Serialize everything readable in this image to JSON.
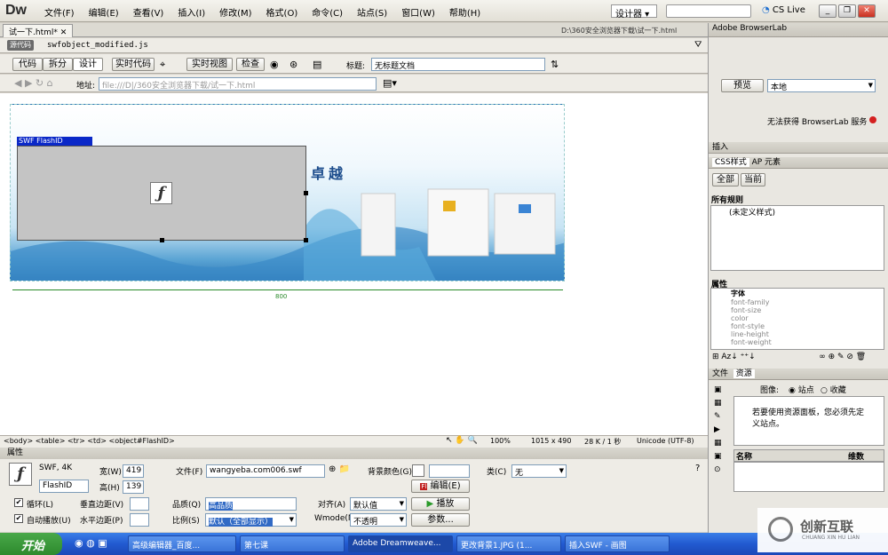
{
  "app": {
    "logo": "Dw",
    "menus": [
      "文件(F)",
      "编辑(E)",
      "查看(V)",
      "插入(I)",
      "修改(M)",
      "格式(O)",
      "命令(C)",
      "站点(S)",
      "窗口(W)",
      "帮助(H)"
    ],
    "workspace": "设计器",
    "cslive": "CS Live"
  },
  "doc": {
    "tab": "试一下.html*",
    "path": "D:\\360安全浏览器下载\\试一下.html",
    "source_chip": "源代码",
    "related_file": "swfobject_modified.js"
  },
  "toolbar": {
    "code": "代码",
    "split": "拆分",
    "design": "设计",
    "live_code": "实时代码",
    "live_view": "实时视图",
    "inspect": "检查",
    "title_label": "标题:",
    "title_value": "无标题文档"
  },
  "address": {
    "label": "地址:",
    "value": "file:///D|/360安全浏览器下载/试一下.html"
  },
  "canvas": {
    "swf_label": "SWF  FlashID",
    "slogan": "卓越",
    "ruler_width": "800"
  },
  "status": {
    "tags": "<body> <table> <tr> <td> <object#FlashID>",
    "zoom": "100%",
    "size": "1015 x 490",
    "weight": "28 K / 1 秒",
    "encoding": "Unicode (UTF-8)"
  },
  "props": {
    "header": "属性",
    "kind": "SWF, 4K",
    "id": "FlashID",
    "w_label": "宽(W)",
    "w": "419",
    "h_label": "高(H)",
    "h": "139",
    "file_label": "文件(F)",
    "file": "wangyeba.com006.swf",
    "bg_label": "背景颜色(G)",
    "edit": "编辑(E)",
    "class_label": "类(C)",
    "class_val": "无",
    "loop": "循环(L)",
    "autoplay": "自动播放(U)",
    "vspace": "垂直边距(V)",
    "hspace": "水平边距(P)",
    "quality_label": "品质(Q)",
    "quality": "高品质",
    "scale_label": "比例(S)",
    "scale": "默认（全部显示）",
    "align_label": "对齐(A)",
    "align": "默认值",
    "wmode_label": "Wmode(M)",
    "wmode": "不透明",
    "play": "播放",
    "params": "参数..."
  },
  "right": {
    "browserlab": "Adobe BrowserLab",
    "preview": "预览",
    "local": "本地",
    "unavailable": "无法获得 BrowserLab 服务",
    "insert": "插入",
    "css_tab": "CSS样式",
    "ap_tab": "AP 元素",
    "all": "全部",
    "current": "当前",
    "all_rules": "所有规则",
    "undefined_style": "(未定义样式)",
    "properties": "属性",
    "font_group": "字体",
    "font_props": [
      "font-family",
      "font-size",
      "color",
      "font-style",
      "line-height",
      "font-weight"
    ],
    "files": "文件",
    "assets": "资源",
    "images": "图像:",
    "site": "站点",
    "favorites": "收藏",
    "assets_msg": "若要使用资源面板，您必须先定义站点。",
    "name_col": "名称",
    "dim_col": "维数"
  },
  "taskbar": {
    "start": "开始",
    "items": [
      "高级编辑器_百度...",
      "第七课",
      "Adobe Dreamweave...",
      "更改背景1.JPG (1...",
      "插入SWF - 画图"
    ]
  },
  "watermark": {
    "cn": "创新互联",
    "en": "CHUANG XIN HU LIAN"
  },
  "colors": {
    "accent": "#0a28c8",
    "brand_red": "#d42020"
  }
}
